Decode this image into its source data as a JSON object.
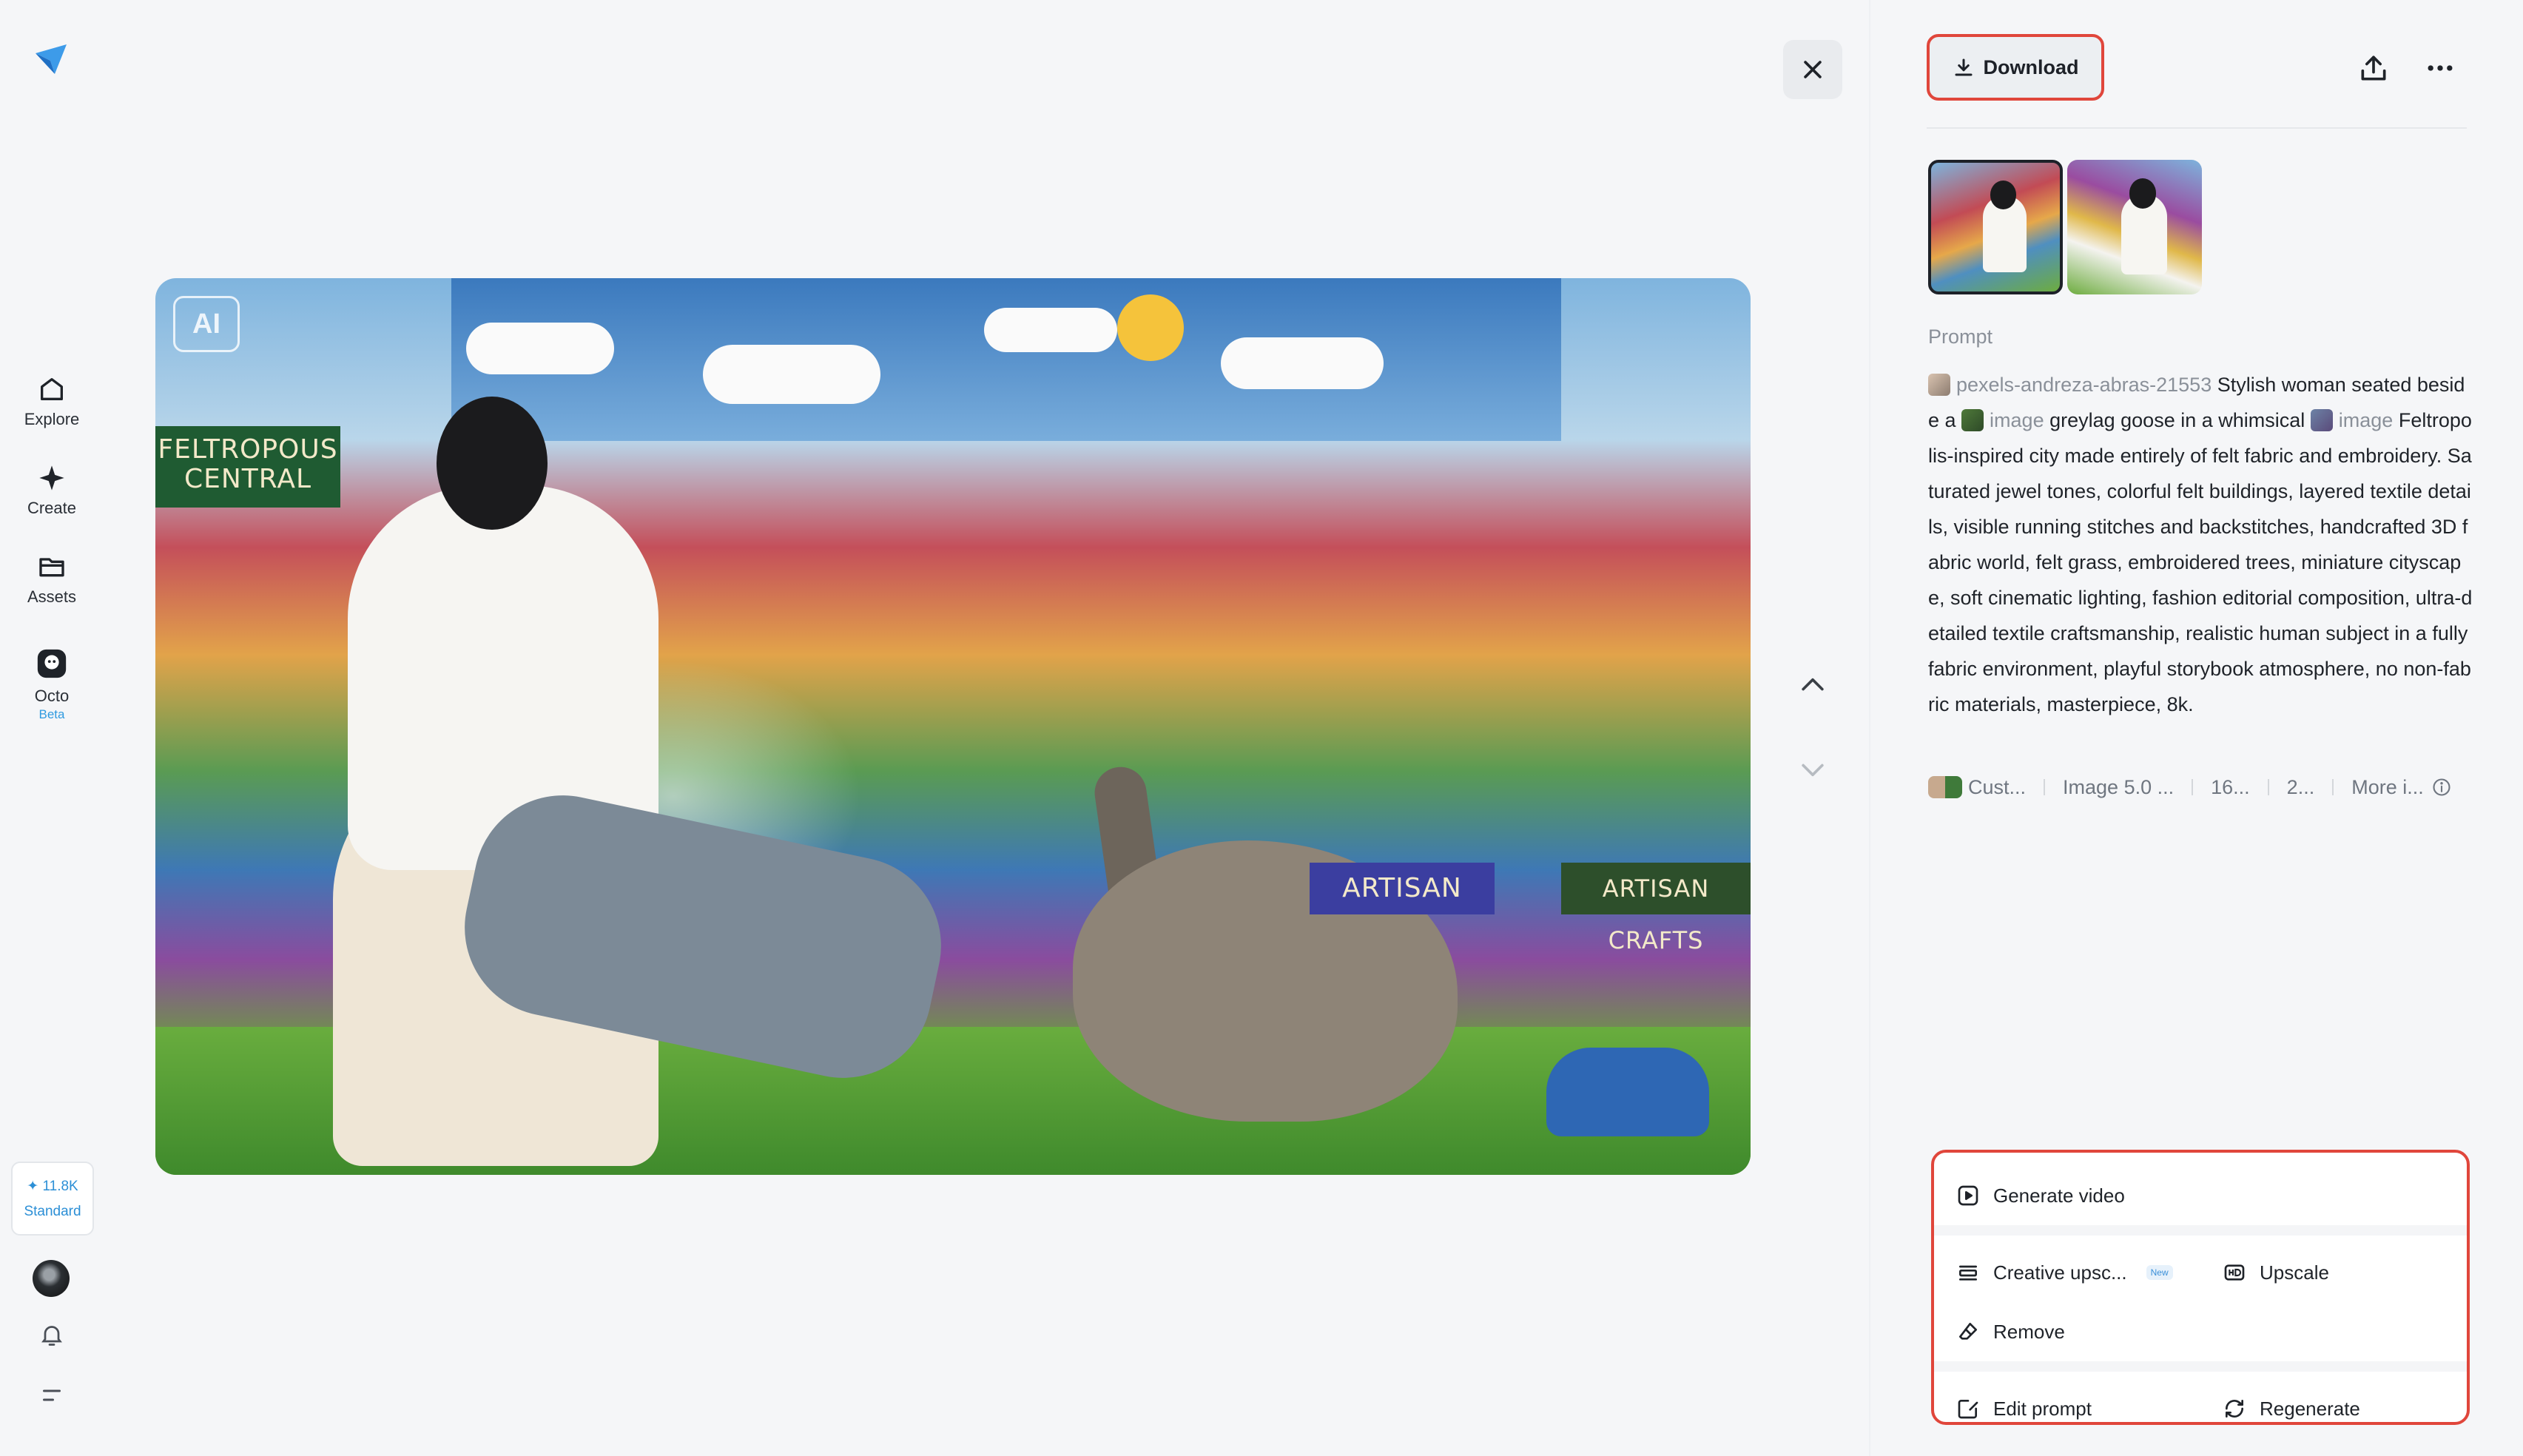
{
  "sidebar": {
    "nav": [
      {
        "id": "explore",
        "label": "Explore"
      },
      {
        "id": "create",
        "label": "Create"
      },
      {
        "id": "assets",
        "label": "Assets"
      },
      {
        "id": "octo",
        "label": "Octo",
        "badge": "Beta"
      }
    ],
    "credits": {
      "amount": "✦ 11.8K",
      "tier": "Standard"
    }
  },
  "image": {
    "ai_badge": "AI",
    "signs": [
      "FELTROPOUS CENTRAL",
      "ARTISAN",
      "ARTISAN CRAFTS"
    ]
  },
  "panel": {
    "download_label": "Download",
    "prompt_title": "Prompt",
    "prompt": {
      "ref1": "pexels-andreza-abras-21553",
      "text1": " Stylish woman seated beside a ",
      "ref2": "image",
      "text2": " greylag goose in a whimsical ",
      "ref3": "image",
      "text3": " Feltropolis-inspired city made entirely of felt fabric and embroidery. Saturated jewel tones, colorful felt buildings, layered textile details, visible running stitches and backstitches, handcrafted 3D fabric world, felt grass, embroidered trees, miniature cityscape, soft cinematic lighting, fashion editorial composition, ultra-detailed textile craftsmanship, realistic human subject in a fully fabric environment, playful storybook atmosphere, no non-fabric materials, masterpiece, 8k."
    },
    "meta": [
      "Cust...",
      "Image 5.0 ...",
      "16...",
      "2...",
      "More i..."
    ],
    "actions": {
      "generate_video": "Generate video",
      "creative_upscale": "Creative upsc...",
      "new_tag": "New",
      "upscale": "Upscale",
      "remove": "Remove",
      "edit_prompt": "Edit prompt",
      "regenerate": "Regenerate"
    }
  },
  "colors": {
    "highlight": "#e0463b",
    "accent": "#2c8fd6"
  }
}
